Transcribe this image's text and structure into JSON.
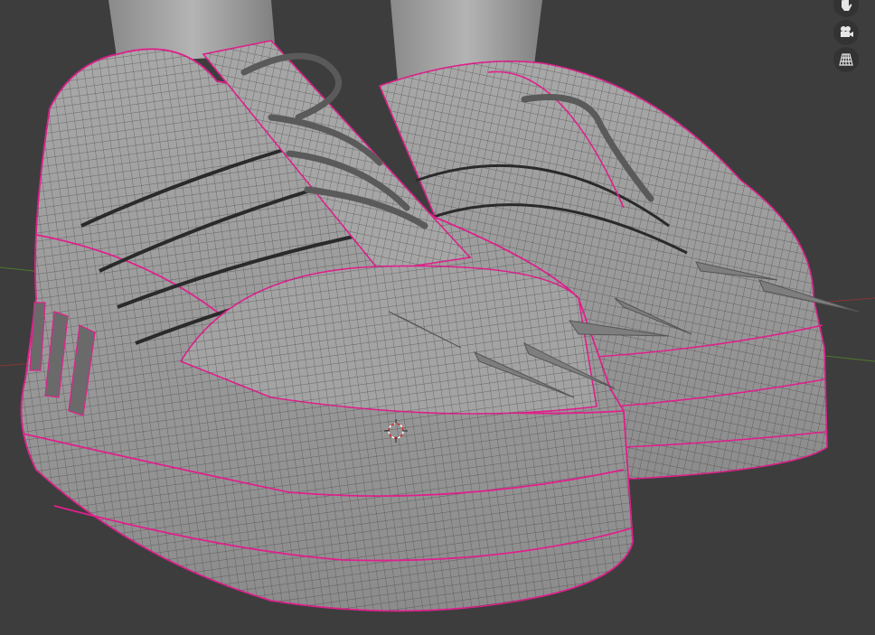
{
  "viewport": {
    "background": "#3d3d3d",
    "mesh_color": "#9a9a9a",
    "wire_color": "#3a3a3a",
    "seam_color": "#e0208c",
    "sharp_edge_color": "#ff3a1a",
    "x_axis_color": "#8a3535",
    "y_axis_color": "#4f7a2a"
  },
  "navigation_gizmo": {
    "buttons": [
      {
        "icon": "hand-pan-icon"
      },
      {
        "icon": "camera-icon"
      },
      {
        "icon": "perspective-grid-icon"
      }
    ]
  }
}
